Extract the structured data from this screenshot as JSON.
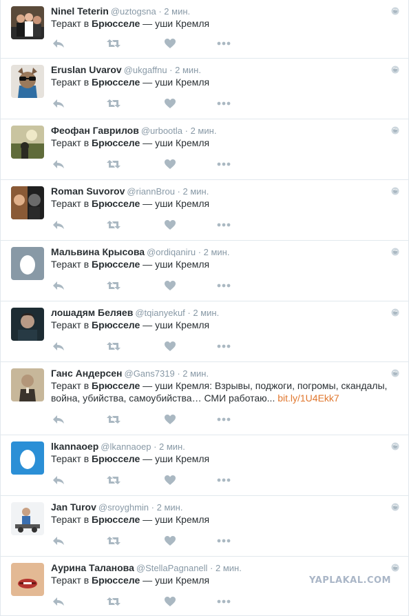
{
  "tweets": [
    {
      "fullname": "Ninel Teterin",
      "username": "@uztogsna",
      "sep": " · ",
      "time": "2 мин.",
      "text_prefix": "Теракт в ",
      "text_bold": "Брюсселе",
      "text_suffix": " — уши Кремля",
      "text_extra": "",
      "link": "",
      "avatar": "photo-group"
    },
    {
      "fullname": "Eruslan Uvarov",
      "username": "@ukgaffnu",
      "sep": " · ",
      "time": "2 мин.",
      "text_prefix": "Теракт в ",
      "text_bold": "Брюсселе",
      "text_suffix": " — уши Кремля",
      "text_extra": "",
      "link": "",
      "avatar": "photo-cartoon-sunglasses"
    },
    {
      "fullname": "Феофан Гаврилов",
      "username": "@urbootla",
      "sep": " · ",
      "time": "2 мин.",
      "text_prefix": "Теракт в ",
      "text_bold": "Брюсселе",
      "text_suffix": " — уши Кремля",
      "text_extra": "",
      "link": "",
      "avatar": "photo-landscape"
    },
    {
      "fullname": "Roman Suvorov",
      "username": "@riannBrou",
      "sep": " · ",
      "time": "2 мин.",
      "text_prefix": "Теракт в ",
      "text_bold": "Брюсселе",
      "text_suffix": " — уши Кремля",
      "text_extra": "",
      "link": "",
      "avatar": "photo-faces"
    },
    {
      "fullname": "Мальвина Крысова",
      "username": "@ordiqaniru",
      "sep": " · ",
      "time": "2 мин.",
      "text_prefix": "Теракт в ",
      "text_bold": "Брюсселе",
      "text_suffix": " — уши Кремля",
      "text_extra": "",
      "link": "",
      "avatar": "egg-gray"
    },
    {
      "fullname": "лошадям Беляев",
      "username": "@tqianyekuf",
      "sep": " · ",
      "time": "2 мин.",
      "text_prefix": "Теракт в ",
      "text_bold": "Брюсселе",
      "text_suffix": " — уши Кремля",
      "text_extra": "",
      "link": "",
      "avatar": "photo-portrait"
    },
    {
      "fullname": "Ганс Андерсен",
      "username": "@Gans7319",
      "sep": " · ",
      "time": "2 мин.",
      "text_prefix": "Теракт в ",
      "text_bold": "Брюсселе",
      "text_suffix": " — уши Кремля: Взрывы, поджоги, погромы, скандалы,",
      "text_extra": "война, убийства, самоубийства… СМИ работаю... ",
      "link": "bit.ly/1U4Ekk7",
      "avatar": "photo-oldman"
    },
    {
      "fullname": "lkannaoep",
      "username": "@lkannaoep",
      "sep": " · ",
      "time": "2 мин.",
      "text_prefix": "Теракт в ",
      "text_bold": "Брюсселе",
      "text_suffix": " — уши Кремля",
      "text_extra": "",
      "link": "",
      "avatar": "egg-blue"
    },
    {
      "fullname": "Jan Turov",
      "username": "@sroyghmin",
      "sep": " · ",
      "time": "2 мин.",
      "text_prefix": "Теракт в ",
      "text_bold": "Брюсселе",
      "text_suffix": " — уши Кремля",
      "text_extra": "",
      "link": "",
      "avatar": "photo-dj"
    },
    {
      "fullname": "Аурина Таланова",
      "username": "@StellaPagnanell",
      "sep": " · ",
      "time": "2 мин.",
      "text_prefix": "Теракт в ",
      "text_bold": "Брюсселе",
      "text_suffix": " — уши Кремля",
      "text_extra": "",
      "link": "",
      "avatar": "photo-lips"
    }
  ],
  "watermark": "YAPLAKAL.COM",
  "icons": {
    "reply": "reply-icon",
    "retweet": "retweet-icon",
    "like": "heart-icon",
    "more": "more-dots-icon",
    "globe": "globe-icon"
  },
  "colors": {
    "icon": "#aab8c2",
    "link": "#e0772e",
    "egg_gray": "#8899a6",
    "egg_blue": "#2b8fd6"
  }
}
